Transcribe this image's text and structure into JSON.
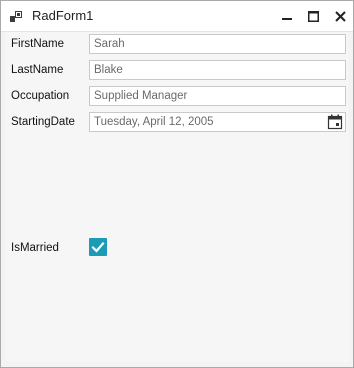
{
  "window": {
    "title": "RadForm1"
  },
  "form": {
    "first_name": {
      "label": "FirstName",
      "value": "Sarah"
    },
    "last_name": {
      "label": "LastName",
      "value": "Blake"
    },
    "occupation": {
      "label": "Occupation",
      "value": "Supplied Manager"
    },
    "starting_date": {
      "label": "StartingDate",
      "value": "Tuesday, April 12, 2005"
    },
    "is_married": {
      "label": "IsMarried",
      "checked": true
    }
  },
  "colors": {
    "accent": "#1b9bb6"
  },
  "icons": [
    "app-icon",
    "minimize-icon",
    "maximize-icon",
    "close-icon",
    "calendar-icon",
    "checkmark-icon"
  ]
}
